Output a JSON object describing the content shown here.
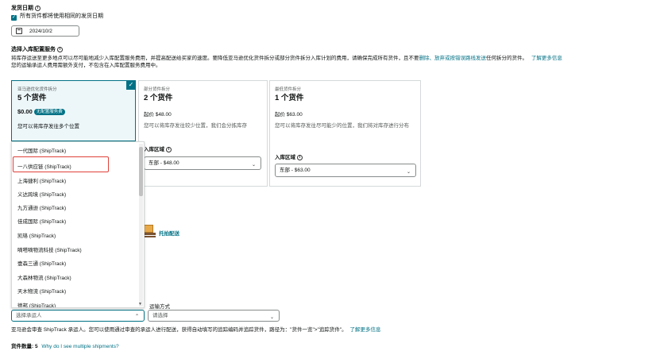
{
  "shipping_date": {
    "title": "发货日期",
    "same_date_label": "所有货件都将使用相同的发货日期",
    "date_value": "2024/10/2"
  },
  "inbound_service": {
    "title": "选择入库配置服务",
    "desc_line1": "将库存运送至更多地点可以尽可能地减少入库配置服务费用，并提高配送给买家的速度。要降低亚马逊优化货件拆分或部分货件拆分入库计划的费用，请确保完成所有货件，且不要",
    "desc_link": "删除、放弃或按错误路线发送",
    "desc_line1_end": "任何拆分的货件。",
    "learn_more": "了解更多信息",
    "desc_line2": "您的运输承运人费用需额外支付，不包含在入库配置服务费用中。"
  },
  "cards": [
    {
      "tag": "亚马逊优化货件拆分",
      "title": "5 个货件",
      "price": "$0.00",
      "badge": "无配置服务费",
      "desc": "您可以将库存发往多个位置"
    },
    {
      "tag": "部分货件拆分",
      "title": "2 个货件",
      "price": "起价 $48.00",
      "desc": "您可以将库存发往较少位置，我们会分拣库存",
      "region_label": "入库区域",
      "region_value": "东部 - $48.00"
    },
    {
      "tag": "最低货件拆分",
      "title": "1 个货件",
      "price": "起价 $63.00",
      "desc": "您可以将库存发往尽可能少的位置，我们将对库存进行分布",
      "region_label": "入库区域",
      "region_value": "东部 - $63.00"
    }
  ],
  "carrier_dropdown": {
    "items": [
      "一代国际 (ShipTrack)",
      "一八供应链 (ShipTrack)",
      "上海捷利 (ShipTrack)",
      "义达跨境 (ShipTrack)",
      "九方通逊 (ShipTrack)",
      "佳成国际 (ShipTrack)",
      "凯珞 (ShipTrack)",
      "嘀嗒嘀物流科技 (ShipTrack)",
      "壹森三通 (ShipTrack)",
      "大森林物流 (ShipTrack)",
      "天木物流 (ShipTrack)",
      "德邦 (ShipTrack)"
    ]
  },
  "pallet": {
    "label": "托拍配送"
  },
  "carrier_select": {
    "placeholder": "选择承运人"
  },
  "shipping_method": {
    "label": "运输方式",
    "placeholder": "请选择"
  },
  "footer": {
    "carrier_note": "亚马逊会审查 ShipTrack 承运人。您可以使用通过审查的承运人进行配送，获得自动填写的追踪编码并追踪货件，路径为：\"货件一览\">\"追踪货件\"。",
    "learn_more": "了解更多信息",
    "shipment_count_label": "货件数量:",
    "shipment_count": "5",
    "why_link": "Why do I see multiple shipments?"
  },
  "colors": {
    "accent": "#007185",
    "highlight": "#e0413a"
  }
}
